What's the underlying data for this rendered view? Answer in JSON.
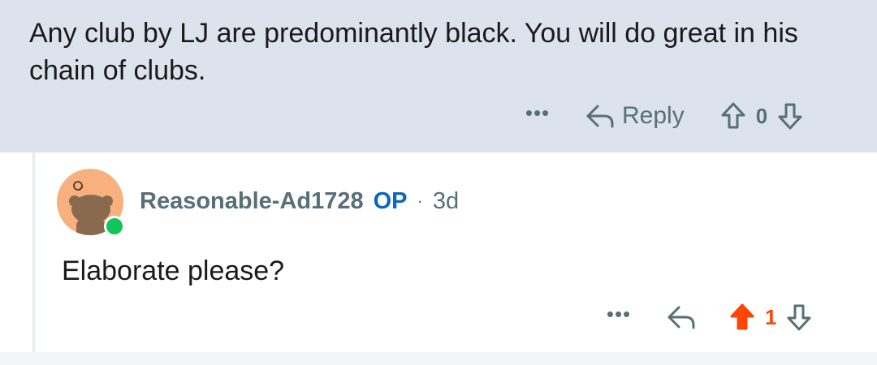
{
  "parent_comment": {
    "body": "Any club by LJ are predominantly black. You will do great in his chain of clubs.",
    "actions": {
      "more_icon": "more-horizontal-icon",
      "more_label": "•••",
      "reply_icon": "reply-arrow-icon",
      "reply_label": "Reply",
      "upvote_icon": "arrow-up-outline-icon",
      "score": "0",
      "downvote_icon": "arrow-down-outline-icon"
    }
  },
  "reply_comment": {
    "author": "Reasonable-Ad1728",
    "op_badge": "OP",
    "separator": "·",
    "age": "3d",
    "avatar_icon": "snoo-avatar-icon",
    "online_status": "online",
    "body": "Elaborate please?",
    "actions": {
      "more_icon": "more-horizontal-icon",
      "more_label": "•••",
      "reply_icon": "reply-arrow-icon",
      "upvote_icon": "arrow-up-filled-icon",
      "score": "1",
      "upvoted": true,
      "downvote_icon": "arrow-down-outline-icon"
    }
  },
  "colors": {
    "parent_background": "#dde3ed",
    "meta_text": "#576f76",
    "op_badge": "#0a66c2",
    "upvote_active": "#ff4500",
    "online_dot": "#10c65a",
    "avatar_background": "#f8b07f"
  }
}
